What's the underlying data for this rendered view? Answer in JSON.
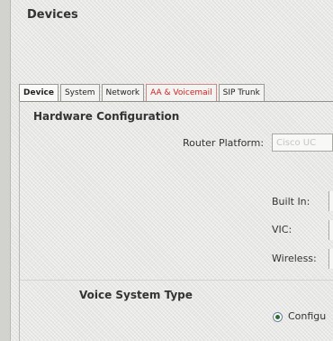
{
  "page": {
    "title": "Devices"
  },
  "tabs": [
    {
      "label": "Device",
      "active": true
    },
    {
      "label": "System"
    },
    {
      "label": "Network"
    },
    {
      "label": "AA & Voicemail",
      "color": "#d21f1f"
    },
    {
      "label": "SIP Trunk"
    }
  ],
  "hardware": {
    "title": "Hardware Configuration",
    "router_platform_label": "Router Platform:",
    "router_platform_value": "Cisco UC",
    "built_in_label": "Built In:",
    "vic_label": "VIC:",
    "wireless_label": "Wireless:"
  },
  "voice_system": {
    "title": "Voice System Type",
    "option_label": "Configu"
  }
}
